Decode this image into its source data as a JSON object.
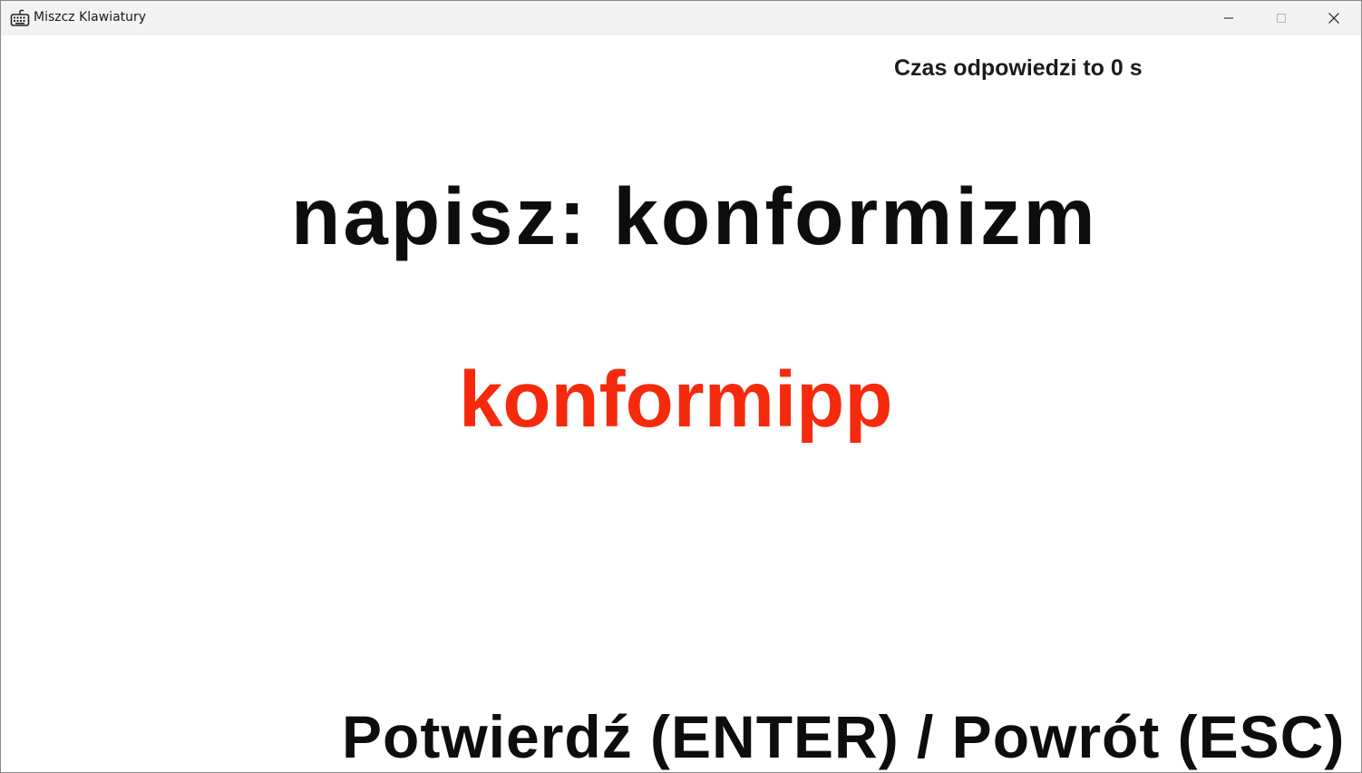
{
  "window": {
    "title": "Miszcz Klawiatury",
    "icon": "keyboard-icon",
    "controls": {
      "minimize_icon": "minimize-icon",
      "maximize_icon": "maximize-icon",
      "close_icon": "close-icon"
    }
  },
  "game": {
    "timer_label": "Czas odpowiedzi to 0 s",
    "prompt": "napisz: konformizm",
    "typed_input": "konformipp",
    "hint": "Potwierdź (ENTER) / Powrót (ESC)"
  },
  "colors": {
    "typed_input": "#f52a0c",
    "text": "#0d0d0d",
    "titlebar": "#f3f3f3"
  }
}
